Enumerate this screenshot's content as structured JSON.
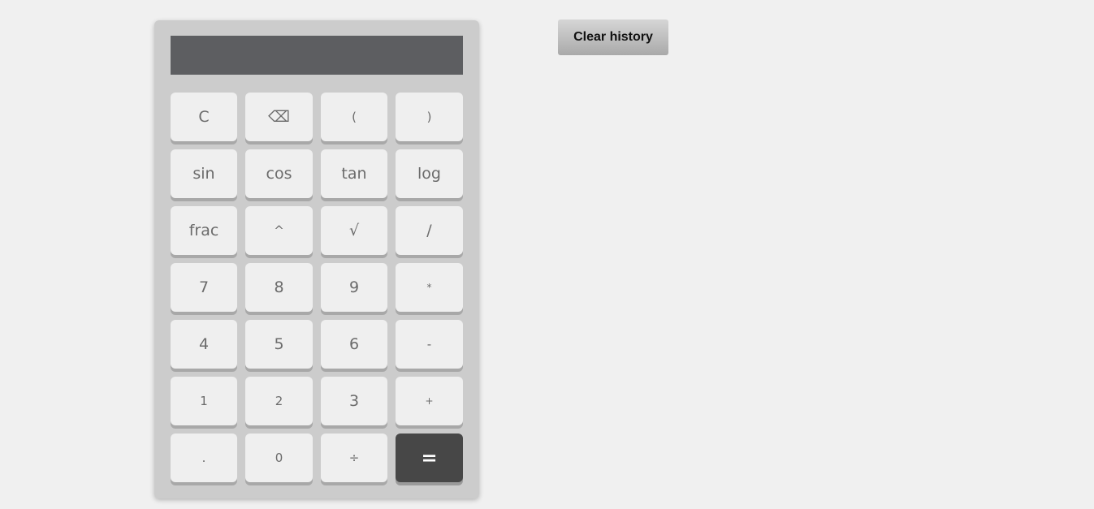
{
  "calculator": {
    "display_value": "",
    "keys": [
      {
        "label": "C",
        "name": "clear-key"
      },
      {
        "label": "⌫",
        "name": "backspace-key"
      },
      {
        "label": "(",
        "name": "open-paren-key"
      },
      {
        "label": ")",
        "name": "close-paren-key"
      },
      {
        "label": "sin",
        "name": "sin-key"
      },
      {
        "label": "cos",
        "name": "cos-key"
      },
      {
        "label": "tan",
        "name": "tan-key"
      },
      {
        "label": "log",
        "name": "log-key"
      },
      {
        "label": "frac",
        "name": "frac-key"
      },
      {
        "label": "^",
        "name": "power-key"
      },
      {
        "label": "√",
        "name": "sqrt-key"
      },
      {
        "label": "/",
        "name": "divide-slash-key"
      },
      {
        "label": "7",
        "name": "digit-7-key"
      },
      {
        "label": "8",
        "name": "digit-8-key"
      },
      {
        "label": "9",
        "name": "digit-9-key"
      },
      {
        "label": "*",
        "name": "multiply-key"
      },
      {
        "label": "4",
        "name": "digit-4-key"
      },
      {
        "label": "5",
        "name": "digit-5-key"
      },
      {
        "label": "6",
        "name": "digit-6-key"
      },
      {
        "label": "-",
        "name": "minus-key"
      },
      {
        "label": "1",
        "name": "digit-1-key"
      },
      {
        "label": "2",
        "name": "digit-2-key"
      },
      {
        "label": "3",
        "name": "digit-3-key"
      },
      {
        "label": "+",
        "name": "plus-key"
      },
      {
        "label": ".",
        "name": "decimal-key"
      },
      {
        "label": "0",
        "name": "digit-0-key"
      },
      {
        "label": "÷",
        "name": "divide-key"
      },
      {
        "label": "=",
        "name": "equals-key"
      }
    ]
  },
  "history": {
    "clear_label": "Clear history"
  },
  "colors": {
    "background": "#f0f0f0",
    "calculator_body": "#cccccc",
    "display": "#5d5e61",
    "key": "#efefef",
    "key_text": "#6b6b6b",
    "equals_key": "#474747"
  }
}
